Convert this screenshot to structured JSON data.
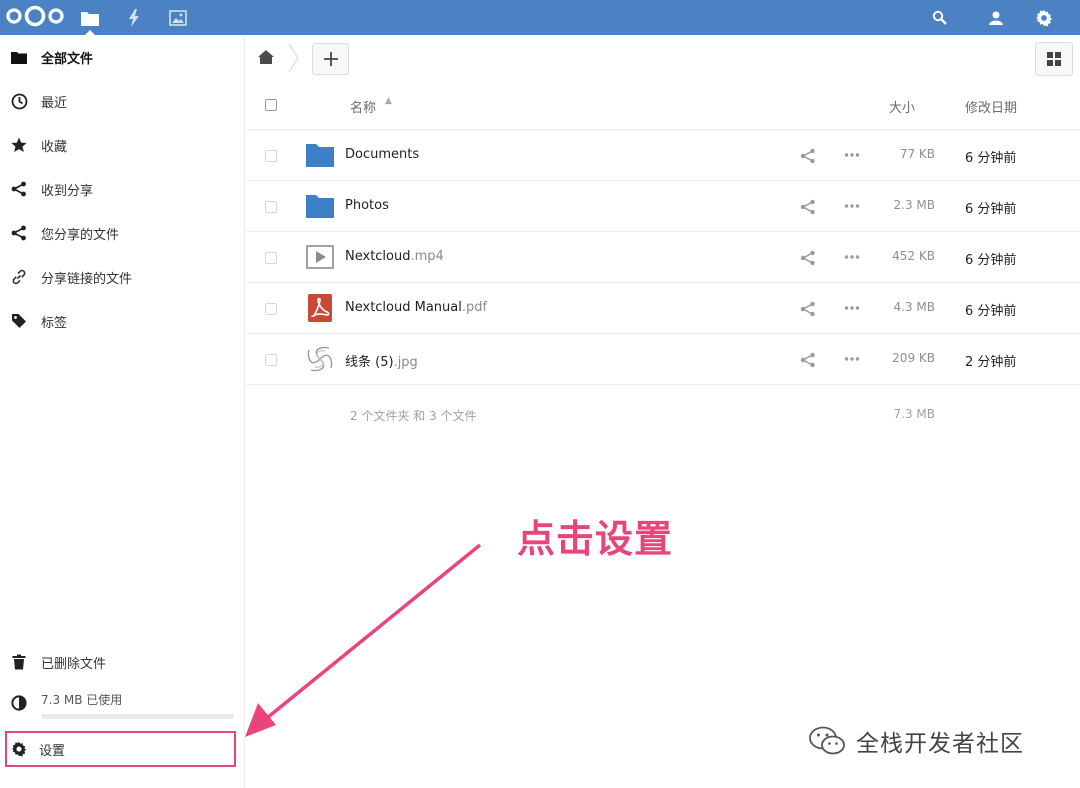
{
  "header": {
    "logo": "nextcloud-logo",
    "apps": [
      "files-icon",
      "activity-icon",
      "gallery-icon"
    ],
    "right_icons": [
      "search-icon",
      "contacts-icon",
      "settings-gear-icon"
    ],
    "color": "#4a82c3"
  },
  "sidebar": {
    "items": [
      {
        "label": "全部文件",
        "icon": "folder-icon"
      },
      {
        "label": "最近",
        "icon": "clock-icon"
      },
      {
        "label": "收藏",
        "icon": "star-icon"
      },
      {
        "label": "收到分享",
        "icon": "share-icon"
      },
      {
        "label": "您分享的文件",
        "icon": "share-icon"
      },
      {
        "label": "分享链接的文件",
        "icon": "link-icon"
      },
      {
        "label": "标签",
        "icon": "tag-icon"
      }
    ],
    "trash": "已删除文件",
    "quota": "7.3 MB 已使用",
    "settings": "设置"
  },
  "table": {
    "col_name": "名称",
    "col_size": "大小",
    "col_modified": "修改日期",
    "rows": [
      {
        "name": "Documents",
        "ext": "",
        "type": "folder",
        "size": "77 KB",
        "date": "6 分钟前"
      },
      {
        "name": "Photos",
        "ext": "",
        "type": "folder",
        "size": "2.3 MB",
        "date": "6 分钟前"
      },
      {
        "name": "Nextcloud",
        "ext": ".mp4",
        "type": "video",
        "size": "452 KB",
        "date": "6 分钟前"
      },
      {
        "name": "Nextcloud Manual",
        "ext": ".pdf",
        "type": "pdf",
        "size": "4.3 MB",
        "date": "6 分钟前"
      },
      {
        "name": "线条 (5)",
        "ext": ".jpg",
        "type": "image",
        "size": "209 KB",
        "date": "2 分钟前"
      }
    ],
    "summary": "2 个文件夹 和 3 个文件",
    "summary_size": "7.3 MB"
  },
  "annotation": {
    "text": "点击设置",
    "color": "#e9457a"
  },
  "watermark": "全栈开发者社区"
}
